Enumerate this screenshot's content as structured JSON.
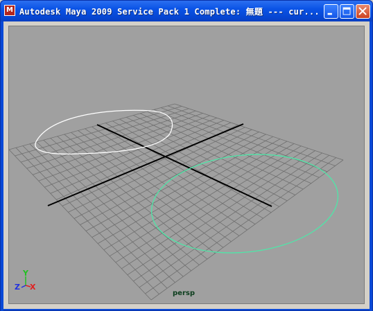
{
  "window": {
    "title": "Autodesk Maya 2009 Service Pack 1 Complete: 無題   ---   cur..."
  },
  "title_buttons": {
    "minimize_icon": "minimize-icon",
    "maximize_icon": "maximize-icon",
    "close_icon": "close-icon"
  },
  "viewport": {
    "camera_label": "persp",
    "background_color": "#a0a0a0",
    "grid_color": "#6f6f6f",
    "axis_line_color": "#000000",
    "white_curve_color": "#ffffff",
    "selected_curve_color": "#4fe6a8"
  },
  "axis_gizmo": {
    "y_label": "Y",
    "z_label": "Z",
    "x_label": "X",
    "colors": {
      "x": "#e02020",
      "y": "#22c022",
      "z": "#2030e0"
    }
  }
}
